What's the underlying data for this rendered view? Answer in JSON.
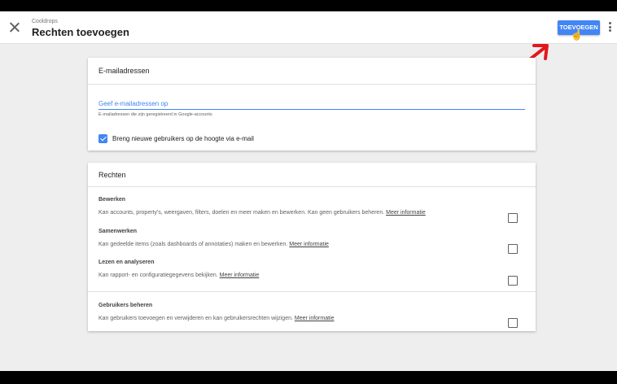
{
  "header": {
    "account": "Cooldrops",
    "title": "Rechten toevoegen",
    "add_button": "TOEVOEGEN"
  },
  "email_card": {
    "heading": "E-mailadressen",
    "input_placeholder": "Geef e-mailadressen op",
    "helper": "E-mailadressen die zijn geregistreerd in Google-accounts",
    "notify_label": "Breng nieuwe gebruikers op de hoogte via e-mail",
    "notify_checked": true
  },
  "permissions_card": {
    "heading": "Rechten",
    "more_info": "Meer informatie",
    "items": [
      {
        "title": "Bewerken",
        "desc": "Kan accounts, property's, weergaven, filters, doelen en meer maken en bewerken. Kan geen gebruikers beheren.",
        "checked": false
      },
      {
        "title": "Samenwerken",
        "desc": "Kan gedeelde items (zoals dashboards of annotaties) maken en bewerken.",
        "checked": false
      },
      {
        "title": "Lezen en analyseren",
        "desc": "Kan rapport- en configuratiegegevens bekijken.",
        "checked": false
      },
      {
        "title": "Gebruikers beheren",
        "desc": "Kan gebruikers toevoegen en verwijderen en kan gebruikersrechten wijzigen.",
        "checked": false
      }
    ]
  },
  "colors": {
    "accent": "#4285f4",
    "annotation_arrow": "#e0191f"
  }
}
